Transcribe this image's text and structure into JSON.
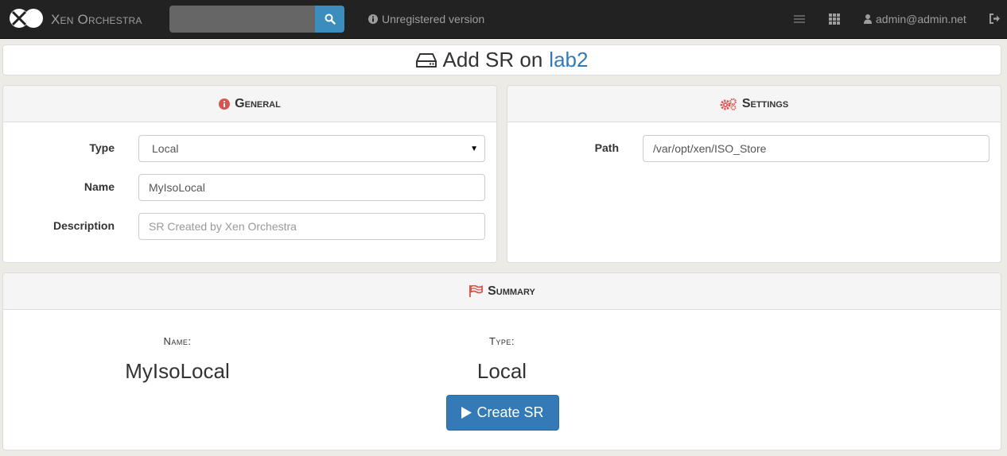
{
  "navbar": {
    "brand": "Xen Orchestra",
    "search_placeholder": "",
    "unregistered": "Unregistered version",
    "user": "admin@admin.net"
  },
  "header": {
    "title_prefix": "Add SR on",
    "host": "lab2"
  },
  "general": {
    "heading": "General",
    "type_label": "Type",
    "type_value": "Local",
    "name_label": "Name",
    "name_value": "MyIsoLocal",
    "description_label": "Description",
    "description_placeholder": "SR Created by Xen Orchestra"
  },
  "settings": {
    "heading": "Settings",
    "path_label": "Path",
    "path_value": "/var/opt/xen/ISO_Store"
  },
  "summary": {
    "heading": "Summary",
    "name_label": "Name:",
    "name_value": "MyIsoLocal",
    "type_label": "Type:",
    "type_value": "Local",
    "create_label": "Create SR"
  },
  "colors": {
    "navbar": "#222222",
    "accent": "#337ab7",
    "icon_red": "#d9534f",
    "background": "#ecebe5"
  },
  "icons": {
    "logo": "xo-logo-icon",
    "search": "search-icon",
    "info": "info-circle-icon",
    "menu": "list-icon",
    "apps": "grid-icon",
    "user": "user-icon",
    "logout": "sign-out-icon",
    "storage": "hdd-icon",
    "general": "info-circle-icon",
    "settings": "cogs-icon",
    "summary": "flag-icon",
    "play": "play-icon"
  }
}
